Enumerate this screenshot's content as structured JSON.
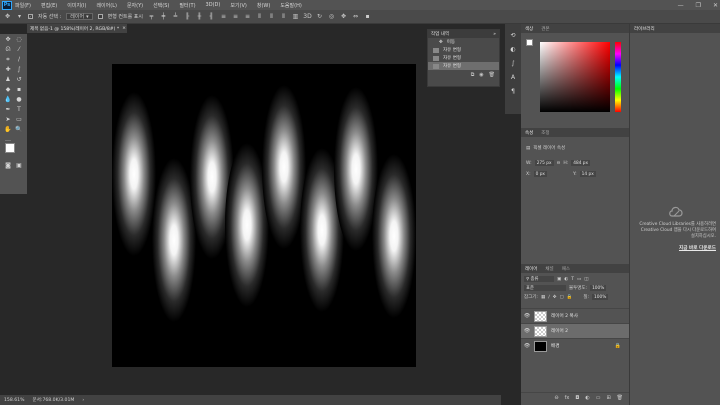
{
  "app": {
    "logo": "Ps"
  },
  "menu": [
    "파일(F)",
    "편집(E)",
    "이미지(I)",
    "레이어(L)",
    "문자(Y)",
    "선택(S)",
    "필터(T)",
    "3D(D)",
    "보기(V)",
    "창(W)",
    "도움말(H)"
  ],
  "window_controls": {
    "minimize": "—",
    "maximize": "❐",
    "close": "✕"
  },
  "options": {
    "auto_select_label": "자동 선택 :",
    "auto_select_value": "레이어",
    "transform_label": "변형 컨트롤 표시"
  },
  "document": {
    "tab_title": "제목 없음-1 @ 158%(레이어 2, RGB/8#) *",
    "zoom": "158.61%",
    "doc_info": "문서:768.0K/3.01M"
  },
  "history": {
    "title": "작업 내역",
    "items": [
      {
        "label": "이동",
        "selected": false
      },
      {
        "label": "자유 변형",
        "selected": false
      },
      {
        "label": "자유 변형",
        "selected": false
      },
      {
        "label": "자유 변형",
        "selected": true
      }
    ]
  },
  "color_panel": {
    "tabs": [
      "색상",
      "견본"
    ],
    "active_tab": "색상"
  },
  "properties": {
    "tabs": [
      "속성",
      "조정"
    ],
    "active_tab": "속성",
    "header": "픽셀 레이어 속성",
    "w_label": "W:",
    "w_value": "275 px",
    "h_label": "H:",
    "h_value": "484 px",
    "x_label": "X:",
    "x_value": "0 px",
    "y_label": "Y:",
    "y_value": "14 px"
  },
  "layers_panel": {
    "tabs": [
      "레이어",
      "채널",
      "패스"
    ],
    "active_tab": "레이어",
    "filter_label": "종류",
    "blend_mode": "표준",
    "opacity_label": "불투명도:",
    "opacity_value": "100%",
    "lock_label": "잠그기:",
    "fill_label": "칠:",
    "fill_value": "100%",
    "layers": [
      {
        "name": "레이어 2 복사",
        "selected": false,
        "thumb": "transparent"
      },
      {
        "name": "레이어 2",
        "selected": true,
        "thumb": "transparent"
      },
      {
        "name": "배경",
        "selected": false,
        "thumb": "black",
        "locked": true
      }
    ]
  },
  "libraries": {
    "title": "라이브러리",
    "message": "Creative Cloud Libraries를 사용하려면 Creative Cloud 앱을 다시 다운로드하여 설치하십시오.",
    "link": "지금 바로 다운로드"
  },
  "colors": {
    "accent": "#31a8ff",
    "foreground": "#ffffff",
    "background": "#000000"
  }
}
